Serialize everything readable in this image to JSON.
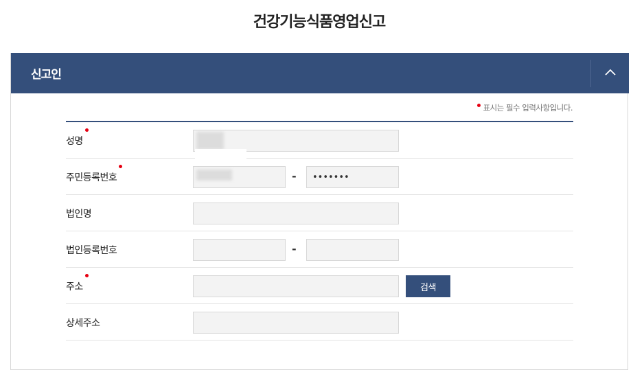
{
  "page": {
    "title": "건강기능식품영업신고"
  },
  "section": {
    "title": "신고인",
    "collapse_icon": "chevron-up-icon",
    "required_note": "표시는 필수 입력사항입니다."
  },
  "form": {
    "name": {
      "label": "성명",
      "required": true,
      "value": ""
    },
    "resident_no": {
      "label": "주민등록번호",
      "required": true,
      "first": "",
      "second": "•••••••",
      "separator": "-"
    },
    "corp_name": {
      "label": "법인명",
      "required": false,
      "value": ""
    },
    "corp_no": {
      "label": "법인등록번호",
      "required": false,
      "first": "",
      "second": "",
      "separator": "-"
    },
    "address": {
      "label": "주소",
      "required": true,
      "value": "",
      "search_label": "검색"
    },
    "address_detail": {
      "label": "상세주소",
      "required": false,
      "value": ""
    }
  },
  "colors": {
    "header": "#344f7b",
    "required_dot": "#e60012",
    "field_bg": "#f3f3f3"
  }
}
